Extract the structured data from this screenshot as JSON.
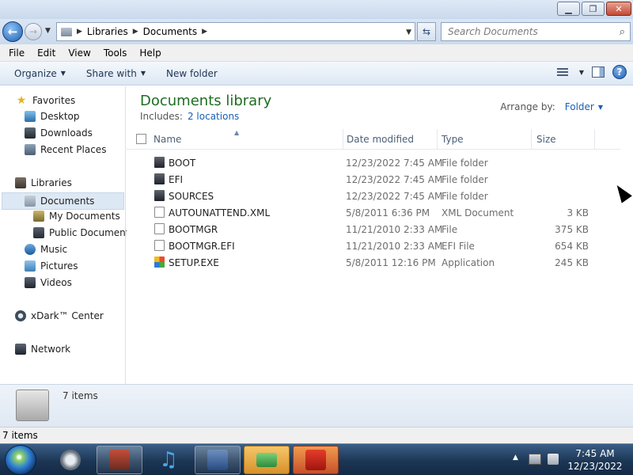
{
  "address": {
    "crumbs": [
      "Libraries",
      "Documents"
    ]
  },
  "search": {
    "placeholder": "Search Documents"
  },
  "menu": [
    "File",
    "Edit",
    "View",
    "Tools",
    "Help"
  ],
  "toolbar": {
    "organize": "Organize",
    "share_with": "Share with",
    "new_folder": "New folder"
  },
  "nav": {
    "favorites": "Favorites",
    "desktop": "Desktop",
    "downloads": "Downloads",
    "recent_places": "Recent Places",
    "libraries": "Libraries",
    "documents": "Documents",
    "my_documents": "My Documents",
    "public_documents": "Public Documents",
    "music": "Music",
    "pictures": "Pictures",
    "videos": "Videos",
    "xdark": "xDark™ Center",
    "network": "Network"
  },
  "library": {
    "title": "Documents library",
    "includes_label": "Includes:",
    "includes_link": "2 locations",
    "arrange_label": "Arrange by:",
    "arrange_value": "Folder"
  },
  "columns": {
    "name": "Name",
    "date": "Date modified",
    "type": "Type",
    "size": "Size"
  },
  "files": [
    {
      "name": "BOOT",
      "date": "12/23/2022 7:45 AM",
      "type": "File folder",
      "size": "",
      "icon": "folder-icon"
    },
    {
      "name": "EFI",
      "date": "12/23/2022 7:45 AM",
      "type": "File folder",
      "size": "",
      "icon": "folder-icon"
    },
    {
      "name": "SOURCES",
      "date": "12/23/2022 7:45 AM",
      "type": "File folder",
      "size": "",
      "icon": "folder-icon"
    },
    {
      "name": "AUTOUNATTEND.XML",
      "date": "5/8/2011 6:36 PM",
      "type": "XML Document",
      "size": "3 KB",
      "icon": "xml-file-icon"
    },
    {
      "name": "BOOTMGR",
      "date": "11/21/2010 2:33 AM",
      "type": "File",
      "size": "375 KB",
      "icon": "file-icon"
    },
    {
      "name": "BOOTMGR.EFI",
      "date": "11/21/2010 2:33 AM",
      "type": "EFI File",
      "size": "654 KB",
      "icon": "file-icon"
    },
    {
      "name": "SETUP.EXE",
      "date": "5/8/2011 12:16 PM",
      "type": "Application",
      "size": "245 KB",
      "icon": "application-icon"
    }
  ],
  "details": {
    "count": "7 items"
  },
  "status": {
    "count": "7 items"
  },
  "clock": {
    "time": "7:45 AM",
    "date": "12/23/2022"
  }
}
